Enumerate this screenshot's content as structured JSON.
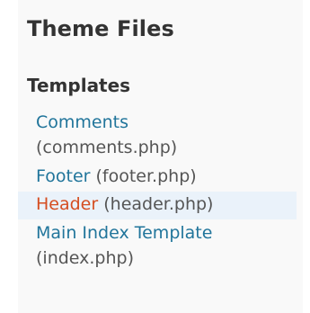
{
  "theme_files": {
    "title": "Theme Files",
    "section_title": "Templates",
    "files": [
      {
        "label": "Comments",
        "filename": "(comments.php)",
        "current": false
      },
      {
        "label": "Footer",
        "filename": "(footer.php)",
        "current": false
      },
      {
        "label": "Header",
        "filename": "(header.php)",
        "current": true
      },
      {
        "label": "Main Index Template",
        "filename": "(index.php)",
        "current": false
      }
    ]
  },
  "colors": {
    "link": "#21759b",
    "current_link": "#d54e21",
    "current_background": "#eaf2fa",
    "text": "#555555",
    "heading": "#333333"
  }
}
